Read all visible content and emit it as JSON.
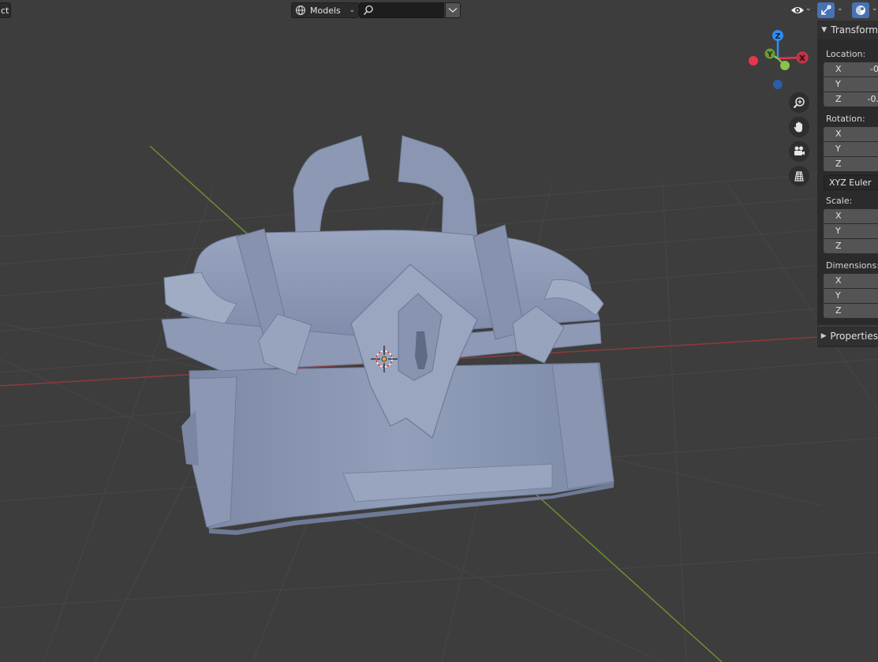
{
  "header": {
    "select_label": "ct",
    "filter": {
      "label": "Models",
      "icon": "globe-icon"
    },
    "search": {
      "value": "",
      "icon": "search-icon"
    },
    "overlays_icon": "eye-icon",
    "gizmo_icon": "gizmo-icon",
    "shading_icon": "viewport-shading-icon"
  },
  "navigation": {
    "axes": {
      "x": "X",
      "y": "Y",
      "z": "Z"
    },
    "tools": [
      "zoom-icon",
      "hand-icon",
      "camera-icon",
      "grid-icon"
    ],
    "colors": {
      "x": "#e8344e",
      "y": "#8bc34a",
      "z": "#2e8ff2"
    }
  },
  "sidebar": {
    "transform_panel": {
      "title": "Transform",
      "location": {
        "label": "Location:",
        "x": {
          "axis": "X",
          "value": "-0"
        },
        "y": {
          "axis": "Y",
          "value": ""
        },
        "z": {
          "axis": "Z",
          "value": "-0."
        }
      },
      "rotation": {
        "label": "Rotation:",
        "x": {
          "axis": "X",
          "value": ""
        },
        "y": {
          "axis": "Y",
          "value": ""
        },
        "z": {
          "axis": "Z",
          "value": ""
        }
      },
      "rotation_mode": "XYZ Euler",
      "scale": {
        "label": "Scale:",
        "x": {
          "axis": "X",
          "value": ""
        },
        "y": {
          "axis": "Y",
          "value": ""
        },
        "z": {
          "axis": "Z",
          "value": ""
        }
      },
      "dimensions": {
        "label": "Dimensions:",
        "x": {
          "axis": "X",
          "value": ""
        },
        "y": {
          "axis": "Y",
          "value": ""
        },
        "z": {
          "axis": "Z",
          "value": ""
        }
      }
    },
    "properties_panel": {
      "title": "Properties"
    }
  },
  "colors": {
    "viewport_bg": "#3d3d3d",
    "x_axis_line": "#8f3a3a",
    "y_axis_line": "#6f8f2e",
    "model_fill": "#8a98b3"
  }
}
